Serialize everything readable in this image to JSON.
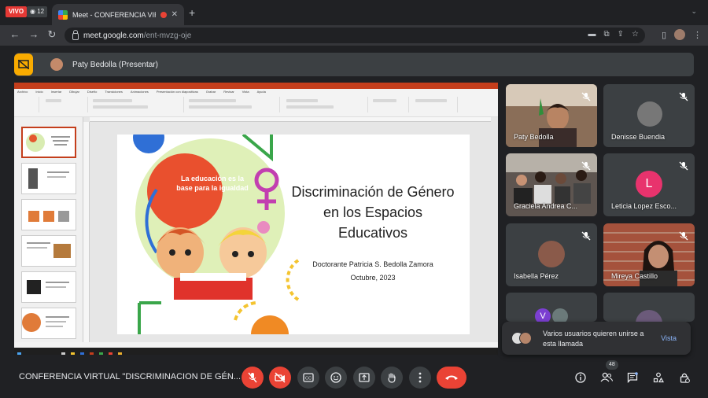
{
  "browser": {
    "live_badge": "VIVO",
    "viewer_count": "12",
    "tab_title": "Meet - CONFERENCIA VIR",
    "url_host": "meet.google.com",
    "url_path": "/ent-mvzg-oje"
  },
  "meet": {
    "presenter_label": "Paty Bedolla (Presentar)",
    "meeting_title": "CONFERENCIA VIRTUAL \"DISCRIMINACION DE GÉN...",
    "people_count": "48",
    "toast": {
      "text": "Varios usuarios quieren unirse a esta llamada",
      "action": "Vista"
    },
    "participants": [
      {
        "name": "Paty Bedolla",
        "muted": true
      },
      {
        "name": "Denisse Buendia",
        "muted": true
      },
      {
        "name": "Graciela Andrea C...",
        "muted": true
      },
      {
        "name": "Leticia Lopez Esco...",
        "muted": true,
        "initial": "L",
        "color": "#e8336d"
      },
      {
        "name": "Isabella Pérez",
        "muted": true
      },
      {
        "name": "Mireya Castillo",
        "muted": true
      },
      {
        "name": "",
        "muted": false,
        "initial": "V",
        "color": "#7b3fd1"
      },
      {
        "name": "",
        "muted": false
      }
    ]
  },
  "slide": {
    "callout": "La educación es la base para la igualdad",
    "title": "Discriminación de Género en los Espacios Educativos",
    "author": "Doctorante Patricia S. Bedolla Zamora",
    "date": "Octubre, 2023"
  },
  "ppt": {
    "tabs": [
      "Archivo",
      "Inicio",
      "Insertar",
      "Dibujar",
      "Diseño",
      "Transiciones",
      "Animaciones",
      "Presentación con diapositivas",
      "Grabar",
      "Revisar",
      "Vista",
      "Ayuda"
    ]
  },
  "colors": {
    "accent_yellow": "#f9ab00",
    "danger_red": "#ea4335",
    "link_blue": "#8ab4f8",
    "ppt_red": "#c43e1c"
  }
}
